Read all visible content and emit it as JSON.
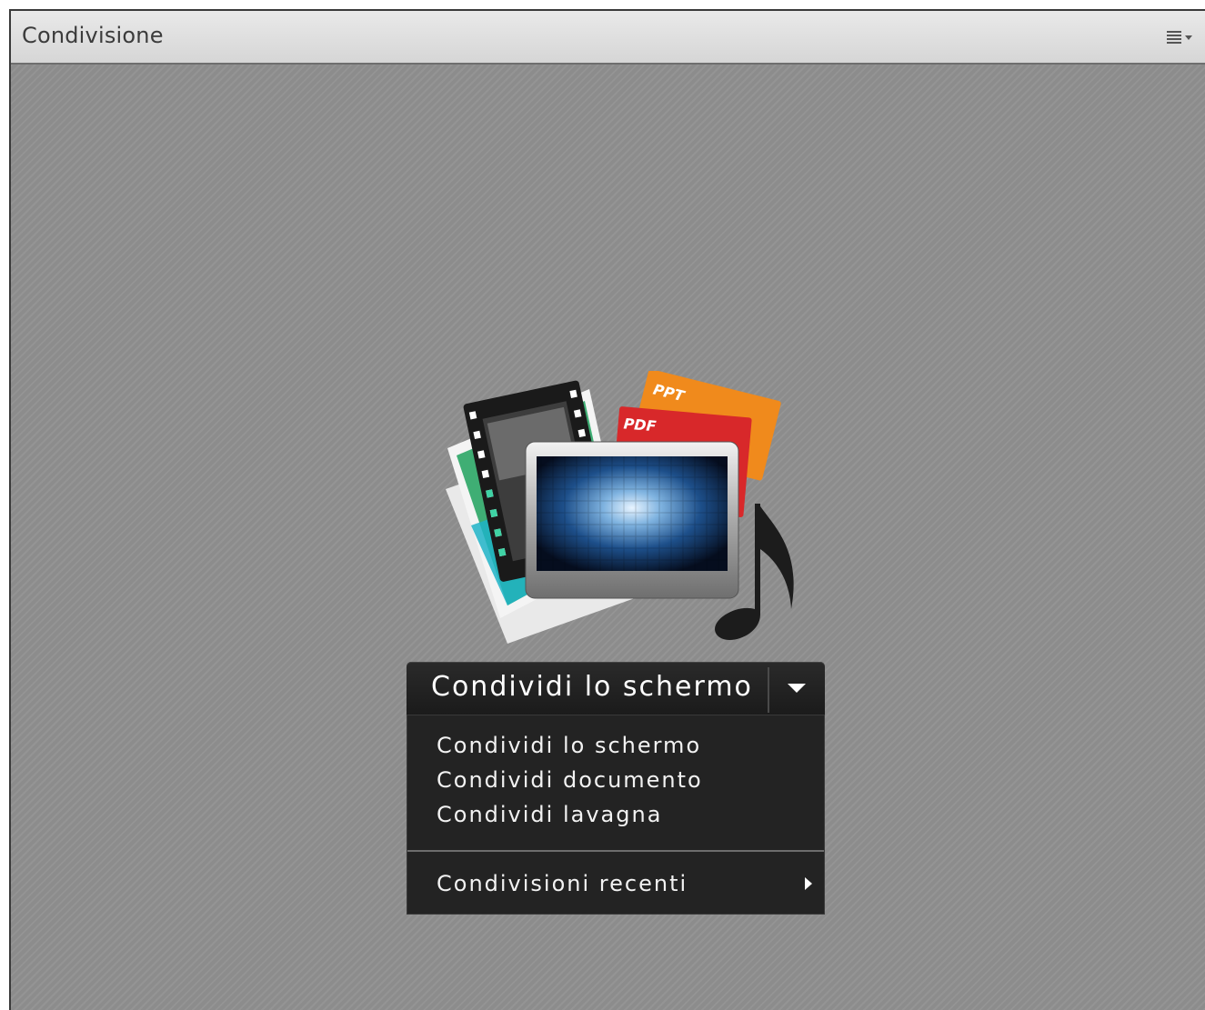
{
  "pod": {
    "title": "Condivisione",
    "menu_icon": "pod-options-menu-icon"
  },
  "hero": {
    "icon": "share-content-illustration",
    "labels": {
      "ppt": "PPT",
      "pdf": "PDF"
    }
  },
  "share_button": {
    "label": "Condividi lo schermo",
    "dropdown_icon": "chevron-down-icon"
  },
  "share_menu": {
    "items": [
      {
        "label": "Condividi lo schermo"
      },
      {
        "label": "Condividi documento"
      },
      {
        "label": "Condividi lavagna"
      }
    ],
    "recent": {
      "label": "Condivisioni recenti",
      "icon": "chevron-right-icon"
    }
  },
  "colors": {
    "background": "#8c8c8c",
    "titlebar": "#dedede",
    "button_dark": "#1f1f1f",
    "menu_bg": "#232323",
    "ppt_orange": "#f08a1c",
    "pdf_red": "#d8282a"
  }
}
